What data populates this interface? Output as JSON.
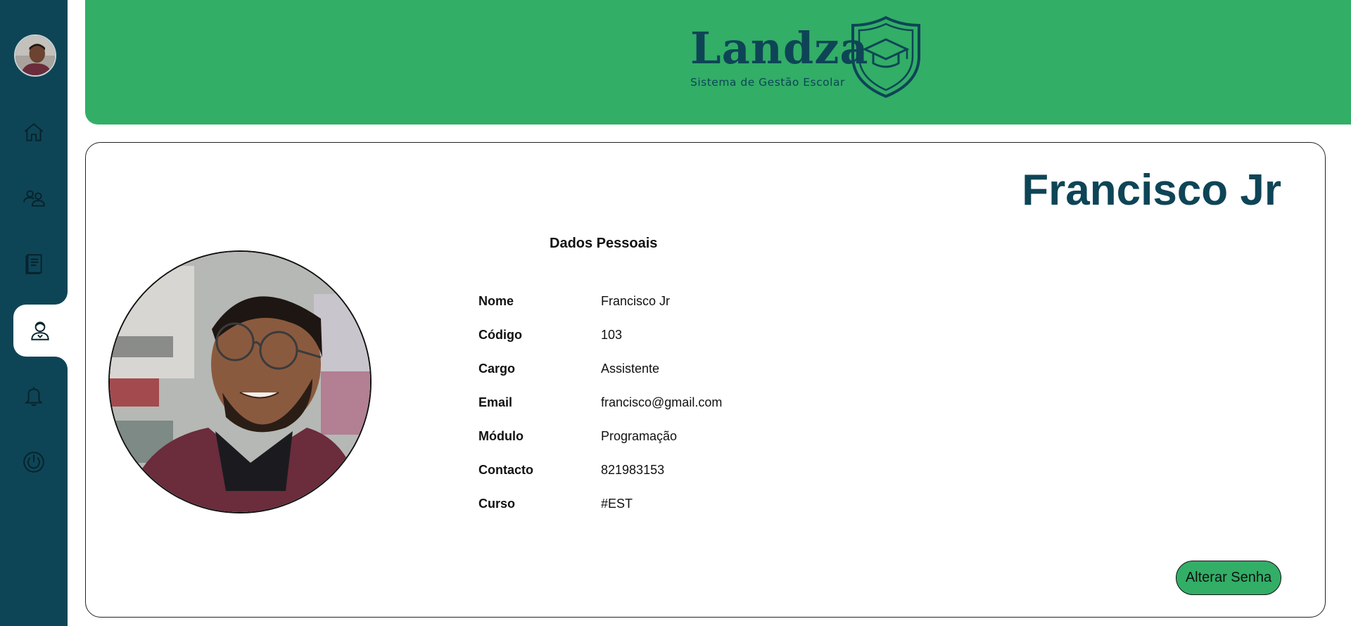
{
  "brand": {
    "name": "Landza",
    "subtitle": "Sistema de Gestão Escolar"
  },
  "sidebar": {
    "items": [
      {
        "icon": "home-icon"
      },
      {
        "icon": "users-icon"
      },
      {
        "icon": "book-icon"
      },
      {
        "icon": "user-icon",
        "active": true
      },
      {
        "icon": "bell-icon"
      },
      {
        "icon": "power-icon"
      }
    ]
  },
  "profile": {
    "name": "Francisco Jr",
    "section_title": "Dados Pessoais",
    "fields": [
      {
        "label": "Nome",
        "value": "Francisco Jr"
      },
      {
        "label": "Código",
        "value": "103"
      },
      {
        "label": "Cargo",
        "value": "Assistente"
      },
      {
        "label": "Email",
        "value": "francisco@gmail.com"
      },
      {
        "label": "Módulo",
        "value": "Programação"
      },
      {
        "label": "Contacto",
        "value": "821983153"
      },
      {
        "label": "Curso",
        "value": "#EST"
      }
    ],
    "button_label": "Alterar Senha"
  },
  "colors": {
    "sidebar": "#0e4556",
    "header": "#32ae67",
    "brand_text": "#0e4556",
    "button": "#32ae67"
  }
}
